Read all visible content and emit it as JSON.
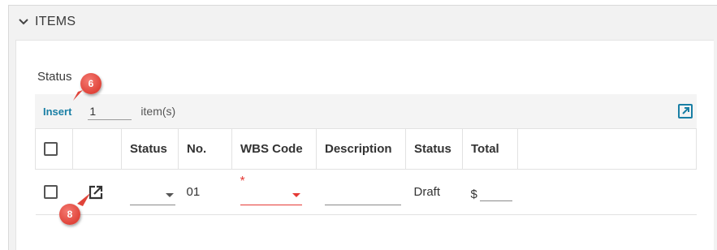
{
  "section": {
    "title": "ITEMS",
    "icon": "chevron-down-icon"
  },
  "panel": {
    "status_label": "Status"
  },
  "toolbar": {
    "insert_label": "Insert",
    "quantity_value": "1",
    "items_label": "item(s)",
    "open_all_icon": "external-link-icon"
  },
  "table": {
    "columns": [
      "",
      "",
      "Status",
      "No.",
      "WBS Code",
      "Description",
      "Status",
      "Total",
      ""
    ],
    "rows": [
      {
        "status_select": "",
        "number": "01",
        "wbs_required_marker": "*",
        "wbs_code": "",
        "description": "",
        "status": "Draft",
        "total_currency": "$",
        "total_value": ""
      }
    ]
  },
  "callouts": [
    {
      "label": "6"
    },
    {
      "label": "8"
    }
  ],
  "colors": {
    "accent": "#1a7fa5",
    "required": "#e53935",
    "callout": "#e0443a",
    "frame_bg": "#f2f2f2",
    "toolbar_bg": "#f4f4f4"
  }
}
